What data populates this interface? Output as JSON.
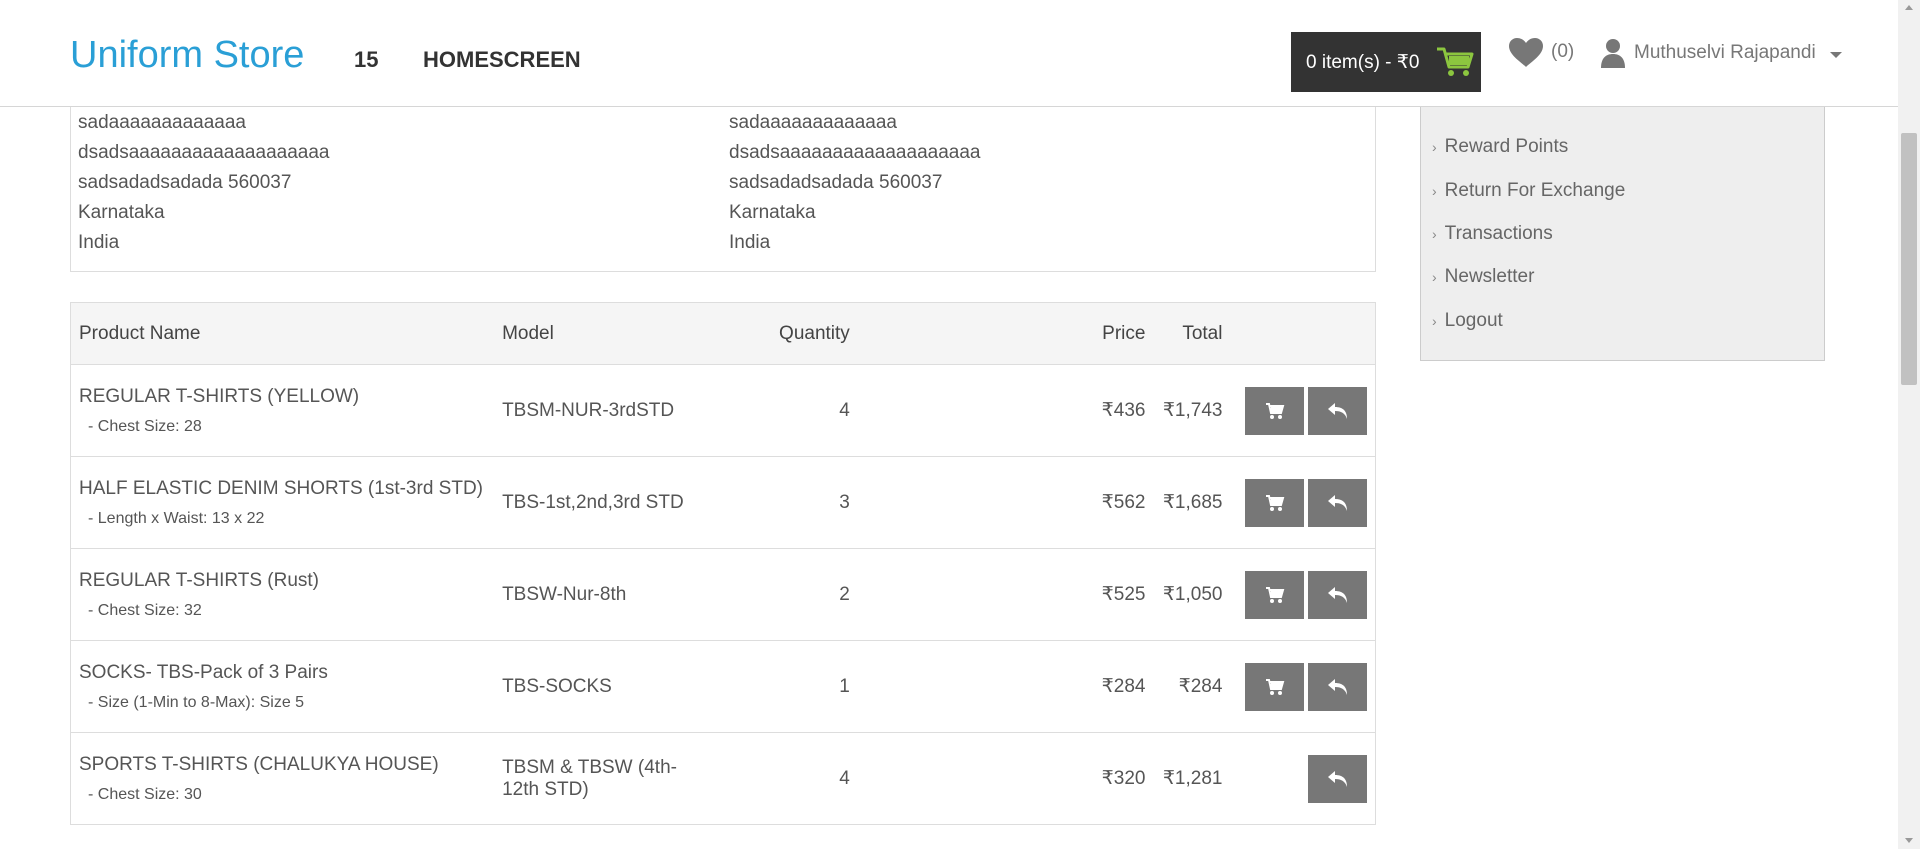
{
  "header": {
    "brand": "Uniform Store",
    "number": "15",
    "home": "HOMESCREEN",
    "cart": "0 item(s) - ₹0",
    "wishlist_count": "(0)",
    "user": "Muthuselvi Rajapandi"
  },
  "address": {
    "left": [
      "sadaaaaaaaaaaaaa",
      "dsadsaaaaaaaaaaaaaaaaaaa",
      "sadsadadsadada 560037",
      "Karnataka",
      "India"
    ],
    "right": [
      "sadaaaaaaaaaaaaa",
      "dsadsaaaaaaaaaaaaaaaaaaa",
      "sadsadadsadada 560037",
      "Karnataka",
      "India"
    ]
  },
  "table": {
    "headers": [
      "Product Name",
      "Model",
      "Quantity",
      "Price",
      "Total"
    ],
    "rows": [
      {
        "name": "REGULAR T-SHIRTS (YELLOW)",
        "option": "- Chest Size: 28",
        "model": "TBSM-NUR-3rdSTD",
        "qty": "4",
        "price": "₹436",
        "total": "₹1,743",
        "reorder": true
      },
      {
        "name": "HALF ELASTIC DENIM SHORTS (1st-3rd STD)",
        "option": "- Length x Waist: 13 x 22",
        "model": "TBS-1st,2nd,3rd STD",
        "qty": "3",
        "price": "₹562",
        "total": "₹1,685",
        "reorder": true
      },
      {
        "name": "REGULAR T-SHIRTS (Rust)",
        "option": "- Chest Size: 32",
        "model": "TBSW-Nur-8th",
        "qty": "2",
        "price": "₹525",
        "total": "₹1,050",
        "reorder": true
      },
      {
        "name": "SOCKS- TBS-Pack of 3 Pairs",
        "option": "- Size (1-Min to 8-Max): Size 5",
        "model": "TBS-SOCKS",
        "qty": "1",
        "price": "₹284",
        "total": "₹284",
        "reorder": true
      },
      {
        "name": "SPORTS T-SHIRTS (CHALUKYA HOUSE)",
        "option": "- Chest Size: 30",
        "model": "TBSM & TBSW (4th-12th STD)",
        "qty": "4",
        "price": "₹320",
        "total": "₹1,281",
        "reorder": false
      }
    ]
  },
  "sidebar": {
    "items": [
      "Reward Points",
      "Return For Exchange",
      "Transactions",
      "Newsletter",
      "Logout"
    ]
  },
  "icons": {
    "cart": "shopping-cart-icon",
    "heart": "heart-icon",
    "user": "user-icon",
    "reorder": "cart-icon",
    "return": "reply-icon"
  },
  "colors": {
    "brand": "#2a9fd6",
    "cart_bg": "#333333",
    "cart_icon": "#8cc63f",
    "action_button": "#777777"
  }
}
